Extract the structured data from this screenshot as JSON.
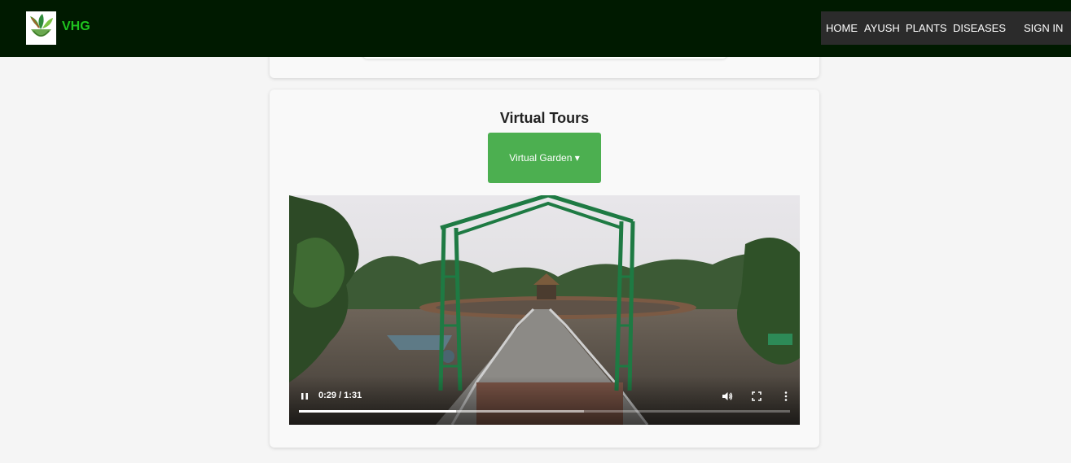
{
  "nav": {
    "brand": "VHG",
    "links": [
      "HOME",
      "AYUSH",
      "PLANTS",
      "DISEASES"
    ],
    "sign_in": "SIGN IN"
  },
  "virtual_tours": {
    "title": "Virtual Tours",
    "dropdown_label": "Virtual Garden ▾"
  },
  "video": {
    "time": "0:29 / 1:31",
    "played_fraction": 0.32,
    "buffered_fraction": 0.58
  },
  "colors": {
    "navbar": "#001a00",
    "brand": "#1fc51f",
    "button": "#4caf50"
  }
}
